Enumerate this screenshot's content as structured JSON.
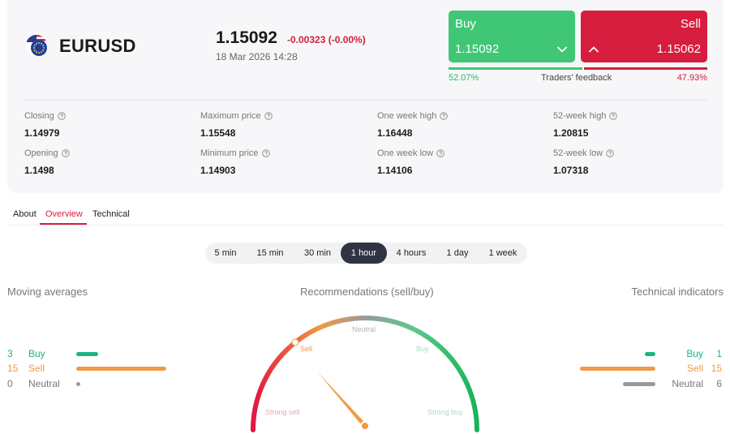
{
  "instrument": {
    "symbol": "EURUSD",
    "flag_icon": "eu-us-flag-icon",
    "price": "1.15092",
    "change": "-0.00323 (-0.00%)",
    "datetime": "18 Mar 2026 14:28"
  },
  "trade": {
    "buy_label": "Buy",
    "buy_price": "1.15092",
    "sell_label": "Sell",
    "sell_price": "1.15062",
    "feedback_label": "Traders' feedback",
    "buy_pct_text": "52.07%",
    "sell_pct_text": "47.93%",
    "buy_fraction": 0.5207,
    "sell_fraction": 0.4793
  },
  "stats": [
    {
      "label": "Closing",
      "value": "1.14979"
    },
    {
      "label": "Maximum price",
      "value": "1.15548"
    },
    {
      "label": "One week high",
      "value": "1.16448"
    },
    {
      "label": "52-week high",
      "value": "1.20815"
    },
    {
      "label": "Opening",
      "value": "1.1498"
    },
    {
      "label": "Minimum price",
      "value": "1.14903"
    },
    {
      "label": "One week low",
      "value": "1.14106"
    },
    {
      "label": "52-week low",
      "value": "1.07318"
    }
  ],
  "tabs": [
    {
      "label": "About",
      "active": false
    },
    {
      "label": "Overview",
      "active": true
    },
    {
      "label": "Technical",
      "active": false
    }
  ],
  "periods": [
    {
      "label": "5 min",
      "active": false
    },
    {
      "label": "15 min",
      "active": false
    },
    {
      "label": "30 min",
      "active": false
    },
    {
      "label": "1 hour",
      "active": true
    },
    {
      "label": "4 hours",
      "active": false
    },
    {
      "label": "1 day",
      "active": false
    },
    {
      "label": "1 week",
      "active": false
    }
  ],
  "moving_averages": {
    "title": "Moving averages",
    "buy": {
      "count": "3",
      "label": "Buy"
    },
    "sell": {
      "count": "15",
      "label": "Sell"
    },
    "neutral": {
      "count": "0",
      "label": "Neutral"
    }
  },
  "recommendations": {
    "title": "Recommendations (sell/buy)",
    "labels": {
      "strong_sell": "Strong sell",
      "sell": "Sell",
      "neutral": "Neutral",
      "buy": "Buy",
      "strong_buy": "Strong buy"
    },
    "needle_value": 0.27
  },
  "technical_indicators": {
    "title": "Technical indicators",
    "buy": {
      "count": "1",
      "label": "Buy"
    },
    "sell": {
      "count": "15",
      "label": "Sell"
    },
    "neutral": {
      "count": "6",
      "label": "Neutral"
    }
  },
  "colors": {
    "buy": "#3fc776",
    "sell": "#d71d3e",
    "ma_buy": "#19b482",
    "ma_sell": "#f09b45",
    "neutral": "#9a9a9a",
    "active_tab": "#d71d3e",
    "active_period_bg": "#2f3342"
  }
}
